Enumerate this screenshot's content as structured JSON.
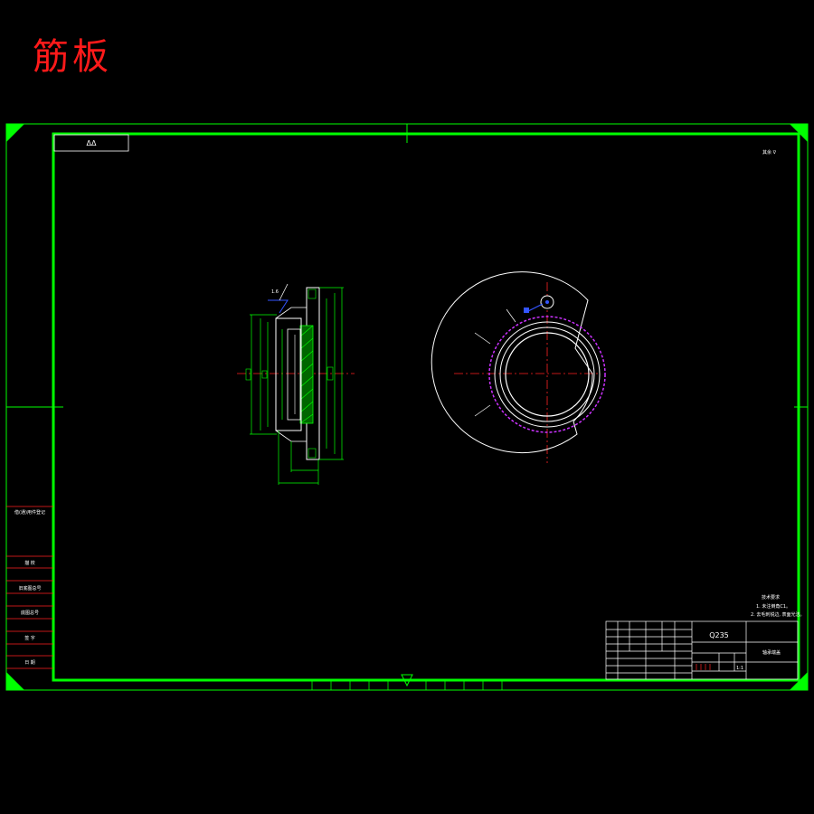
{
  "heading": "筋板",
  "stamp_box": "ΔΔ",
  "corner_note": "其余 ∇",
  "material": "Q235",
  "part_name": "轴承端盖",
  "scale": "1:1",
  "side_labels": [
    "借(通)用件登记",
    "描 校",
    "旧底图总号",
    "底图总号",
    "签 字",
    "日 期"
  ],
  "tech_notes": [
    "技术要求",
    "1. 未注倒角C1。",
    "2. 去毛刺锐边, 表面光洁。"
  ],
  "colors": {
    "frame": "#00ff00",
    "outline": "#ffffff",
    "center_line": "#ff2222",
    "highlight": "#cc33ff",
    "dimension": "#00ff00",
    "annotation": "#3355ff",
    "title": "#ff1a1a"
  }
}
